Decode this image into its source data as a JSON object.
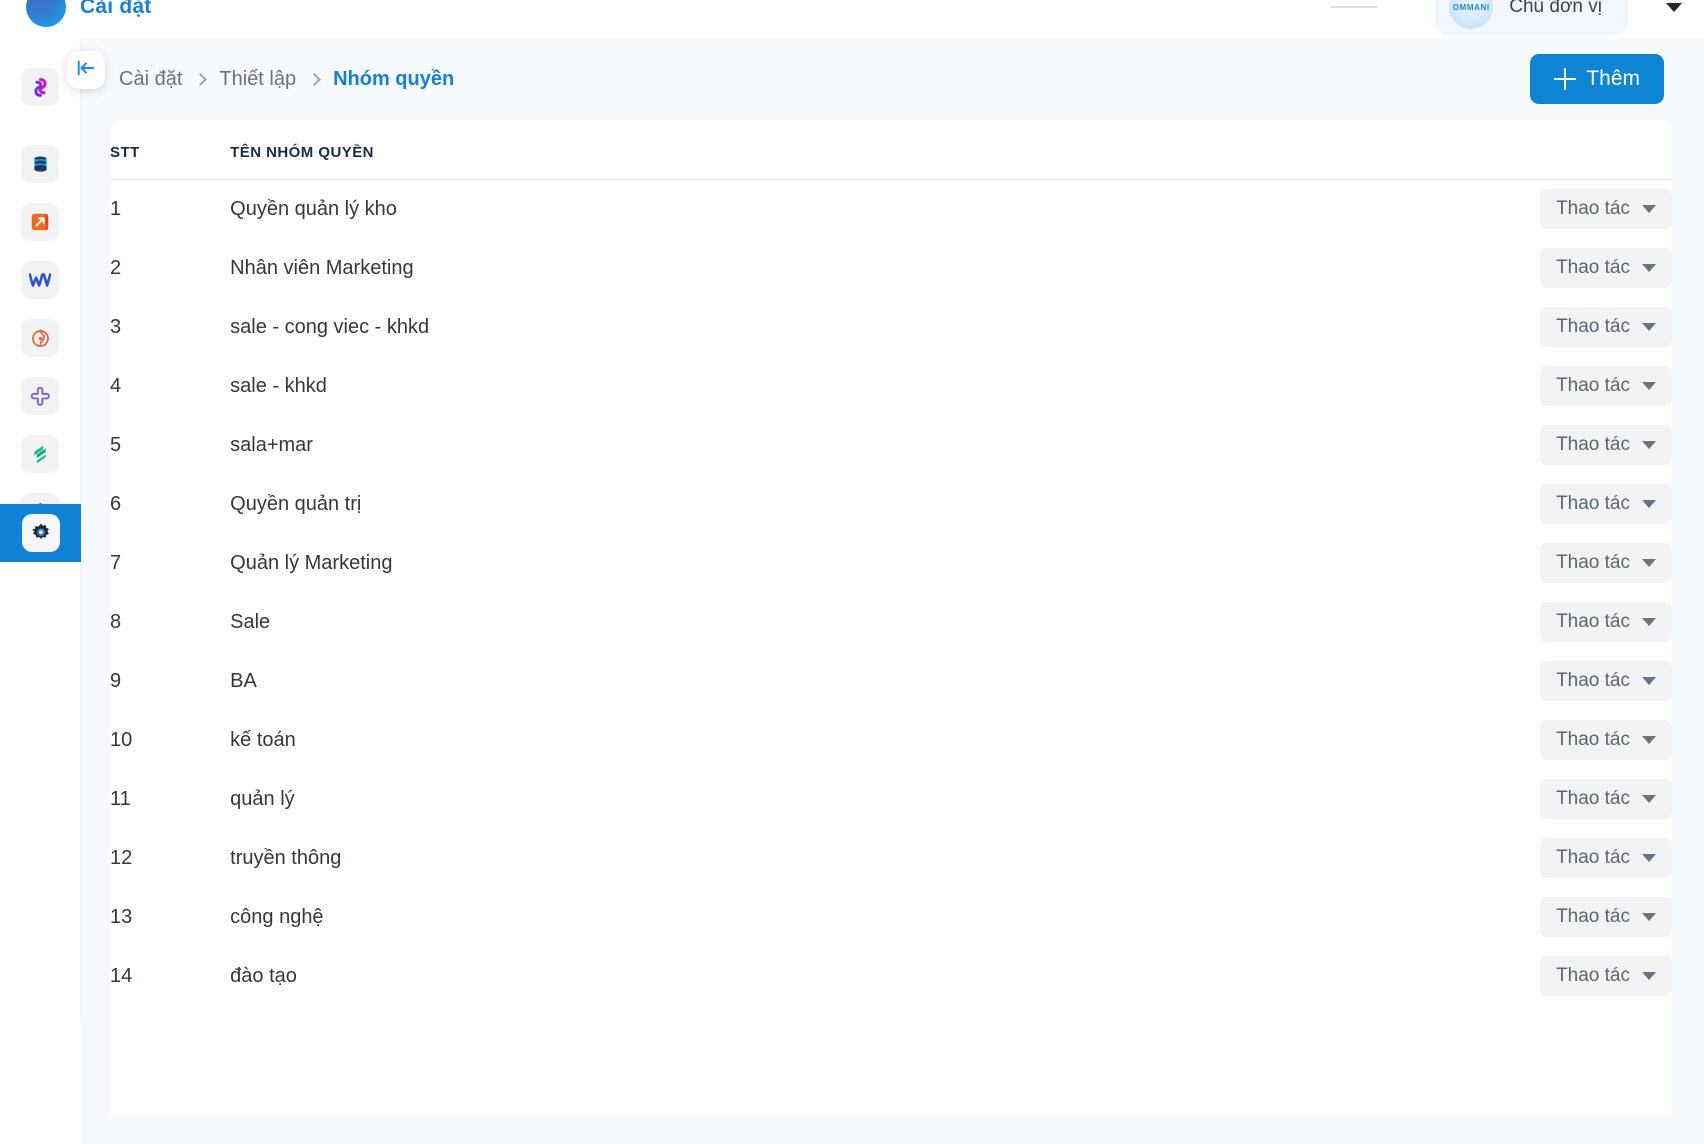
{
  "topbar": {
    "brand_title": "Cài đặt",
    "brand_logo_icon": "circle-logo",
    "org_badge_text": "OMMANI",
    "org_role": "Chủ đơn vị",
    "caret_icon": "chevron-down-icon"
  },
  "rail": {
    "items": [
      {
        "name": "app-sync",
        "icon": "sync-swirl-icon"
      },
      {
        "name": "app-database",
        "icon": "database-icon"
      },
      {
        "name": "app-launch",
        "icon": "arrow-square-icon"
      },
      {
        "name": "app-wiki",
        "icon": "w-letter-icon"
      },
      {
        "name": "app-compass",
        "icon": "compass-swirl-icon"
      },
      {
        "name": "app-plugin",
        "icon": "cross-clover-icon"
      },
      {
        "name": "app-finance",
        "icon": "layers-icon"
      },
      {
        "name": "app-people",
        "icon": "people-tree-icon"
      },
      {
        "name": "app-settings",
        "icon": "gear-icon"
      }
    ]
  },
  "collapse_button": {
    "icon": "collapse-left-icon"
  },
  "breadcrumb": {
    "items": [
      {
        "label": "Cài đặt",
        "current": false
      },
      {
        "label": "Thiết lập",
        "current": false
      },
      {
        "label": "Nhóm quyền",
        "current": true
      }
    ],
    "separator_icon": "chevron-right-icon"
  },
  "add_button": {
    "label": "Thêm",
    "icon": "plus-icon"
  },
  "table": {
    "columns": [
      "STT",
      "TÊN NHÓM QUYỀN",
      ""
    ],
    "action_label": "Thao tác",
    "action_caret_icon": "caret-down-icon",
    "rows": [
      {
        "stt": "1",
        "name": "Quyền quản lý kho"
      },
      {
        "stt": "2",
        "name": "Nhân viên Marketing"
      },
      {
        "stt": "3",
        "name": "sale - cong viec - khkd"
      },
      {
        "stt": "4",
        "name": "sale - khkd"
      },
      {
        "stt": "5",
        "name": "sala+mar"
      },
      {
        "stt": "6",
        "name": "Quyền quản trị"
      },
      {
        "stt": "7",
        "name": "Quản lý Marketing"
      },
      {
        "stt": "8",
        "name": "Sale"
      },
      {
        "stt": "9",
        "name": "BA"
      },
      {
        "stt": "10",
        "name": "kế toán"
      },
      {
        "stt": "11",
        "name": "quản lý"
      },
      {
        "stt": "12",
        "name": "truyền thông"
      },
      {
        "stt": "13",
        "name": "công nghệ"
      },
      {
        "stt": "14",
        "name": "đào tạo"
      }
    ]
  },
  "colors": {
    "accent": "#0d84d4",
    "breadcrumb_active": "#1281d6",
    "page_bg": "#f7fafd",
    "action_bg": "#f2f3f5"
  }
}
